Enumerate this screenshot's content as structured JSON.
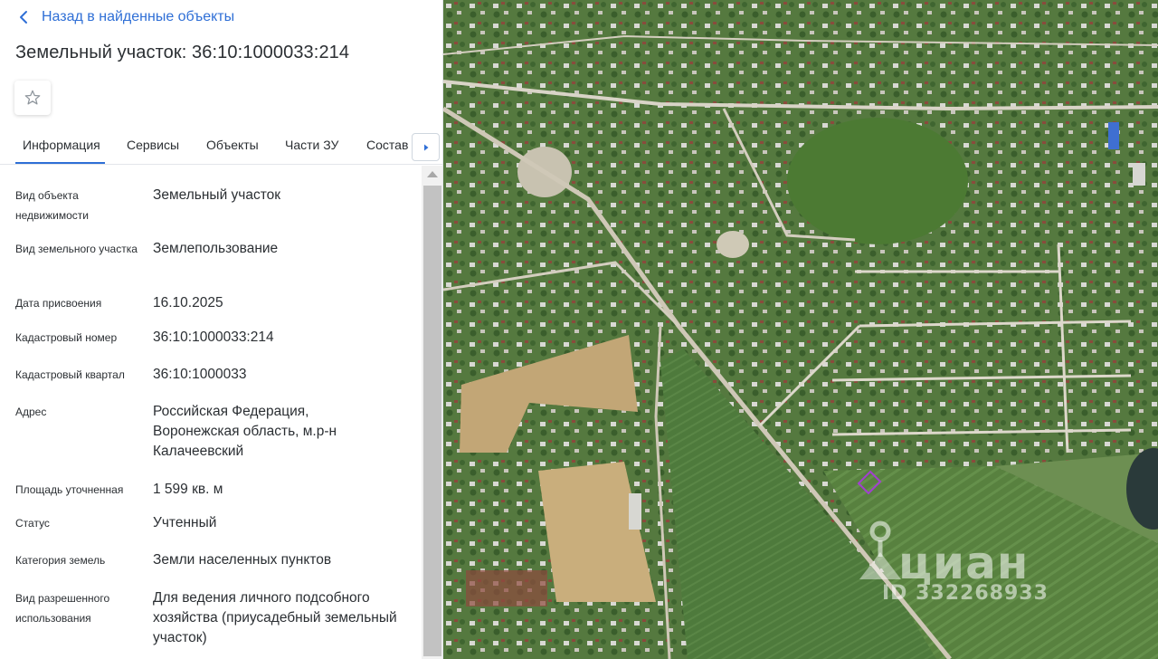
{
  "back_link": {
    "label": "Назад в найденные объекты",
    "icon": "chevron-left-icon"
  },
  "title": "Земельный участок: 36:10:1000033:214",
  "favorite": {
    "icon": "star-outline-icon"
  },
  "tabs": [
    {
      "label": "Информация",
      "active": true
    },
    {
      "label": "Сервисы",
      "active": false
    },
    {
      "label": "Объекты",
      "active": false
    },
    {
      "label": "Части ЗУ",
      "active": false
    },
    {
      "label": "Состав",
      "active": false
    }
  ],
  "info": [
    {
      "label": "Вид объекта недвижимости",
      "value": "Земельный участок"
    },
    {
      "label": "Вид земельного участка",
      "value": "Землепользование"
    },
    {
      "label": "Дата присвоения",
      "value": "16.10.2025"
    },
    {
      "label": "Кадастровый номер",
      "value": "36:10:1000033:214"
    },
    {
      "label": "Кадастровый квартал",
      "value": "36:10:1000033"
    },
    {
      "label": "Адрес",
      "value": "Российская Федерация, Воронежская область, м.р-н Калачеевский"
    },
    {
      "label": "Площадь уточненная",
      "value": "1 599 кв. м"
    },
    {
      "label": "Статус",
      "value": "Учтенный"
    },
    {
      "label": "Категория земель",
      "value": "Земли населенных пунктов"
    },
    {
      "label": "Вид разрешенного использования",
      "value": "Для ведения личного подсобного хозяйства (приусадебный земельный участок)"
    }
  ],
  "map": {
    "watermark_brand": "циан",
    "watermark_id": "ID 332268933",
    "parcel_color": "#a23fd0"
  },
  "colors": {
    "accent": "#2f6fd6",
    "text": "#2b2f33"
  }
}
